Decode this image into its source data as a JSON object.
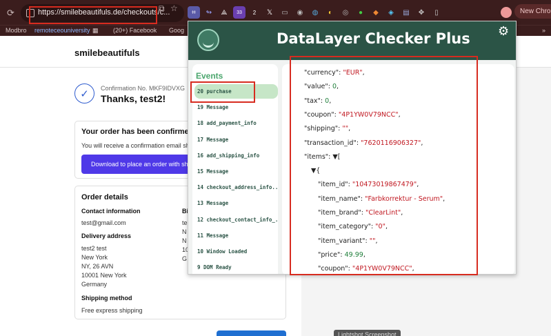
{
  "browser": {
    "url": "https://smilebeautifuls.de/checkouts/c...",
    "new_chrome_label": "New Chrome",
    "bookmarks": [
      "Modbro",
      "remoteceouniversity",
      "(20+) Facebook",
      "Goog"
    ],
    "extension_badges": [
      "33",
      "2"
    ]
  },
  "page": {
    "store_name": "smilebeautifuls",
    "confirmation_no": "Confirmation No. MKF9IDVXG",
    "thanks": "Thanks, test2!",
    "confirmed_title": "Your order has been confirmed.",
    "confirmed_text": "You will receive a confirmation email sh",
    "download_button": "Download to place an order with sh",
    "order_details_title": "Order details",
    "contact_label": "Contact information",
    "contact_email": "test@gmail.com",
    "billing_label_partial": "Bi",
    "delivery_label": "Delivery address",
    "delivery_lines": [
      "test2 test",
      "New York",
      "NY, 26 AVN",
      "10001 New York",
      "Germany"
    ],
    "billing_fragments": [
      "te",
      "N",
      "N",
      "10",
      "G"
    ],
    "shipping_method_label": "Shipping method",
    "shipping_method": "Free express shipping",
    "lightshot_label": "Lightshot Screenshot"
  },
  "popup": {
    "title": "DataLayer Checker Plus",
    "events_heading": "Events",
    "events": [
      {
        "label": "20 purchase",
        "selected": true
      },
      {
        "label": "19 Message",
        "selected": false
      },
      {
        "label": "18 add_payment_info",
        "selected": false
      },
      {
        "label": "17 Message",
        "selected": false
      },
      {
        "label": "16 add_shipping_info",
        "selected": false
      },
      {
        "label": "15 Message",
        "selected": false
      },
      {
        "label": "14 checkout_address_info...",
        "selected": false
      },
      {
        "label": "13 Message",
        "selected": false
      },
      {
        "label": "12 checkout_contact_info_...",
        "selected": false
      },
      {
        "label": "11 Message",
        "selected": false
      },
      {
        "label": "10 Window Loaded",
        "selected": false
      },
      {
        "label": "9 DOM Ready",
        "selected": false
      }
    ],
    "json_lines": [
      {
        "indent": 0,
        "key": "\"currency\"",
        "value": "\"EUR\"",
        "type": "str"
      },
      {
        "indent": 0,
        "key": "\"value\"",
        "value": "0",
        "type": "num"
      },
      {
        "indent": 0,
        "key": "\"tax\"",
        "value": "0",
        "type": "num"
      },
      {
        "indent": 0,
        "key": "\"coupon\"",
        "value": "\"4P1YW0V79NCC\"",
        "type": "str"
      },
      {
        "indent": 0,
        "key": "\"shipping\"",
        "value": "\"\"",
        "type": "str"
      },
      {
        "indent": 0,
        "key": "\"transaction_id\"",
        "value": "\"7620116906327\"",
        "type": "str"
      },
      {
        "indent": 0,
        "key": "\"items\"",
        "value": "▼[",
        "type": "plain"
      },
      {
        "indent": 1,
        "key": "",
        "value": "▼{",
        "type": "plain"
      },
      {
        "indent": 2,
        "key": "\"item_id\"",
        "value": "\"10473019867479\"",
        "type": "str"
      },
      {
        "indent": 2,
        "key": "\"item_name\"",
        "value": "\"Farbkorrektur - Serum\"",
        "type": "str"
      },
      {
        "indent": 2,
        "key": "\"item_brand\"",
        "value": "\"ClearLint\"",
        "type": "str"
      },
      {
        "indent": 2,
        "key": "\"item_category\"",
        "value": "\"0\"",
        "type": "str"
      },
      {
        "indent": 2,
        "key": "\"item_variant\"",
        "value": "\"\"",
        "type": "str"
      },
      {
        "indent": 2,
        "key": "\"price\"",
        "value": "49.99",
        "type": "num"
      },
      {
        "indent": 2,
        "key": "\"coupon\"",
        "value": "\"4P1YW0V79NCC\"",
        "type": "str"
      }
    ]
  },
  "colors": {
    "popup_header": "#2b5446",
    "events_green": "#4ba66d",
    "json_string": "#c0161f",
    "json_number": "#1f7f3a",
    "annotation_red": "#d72b1f",
    "download_button": "#4f39e8"
  }
}
